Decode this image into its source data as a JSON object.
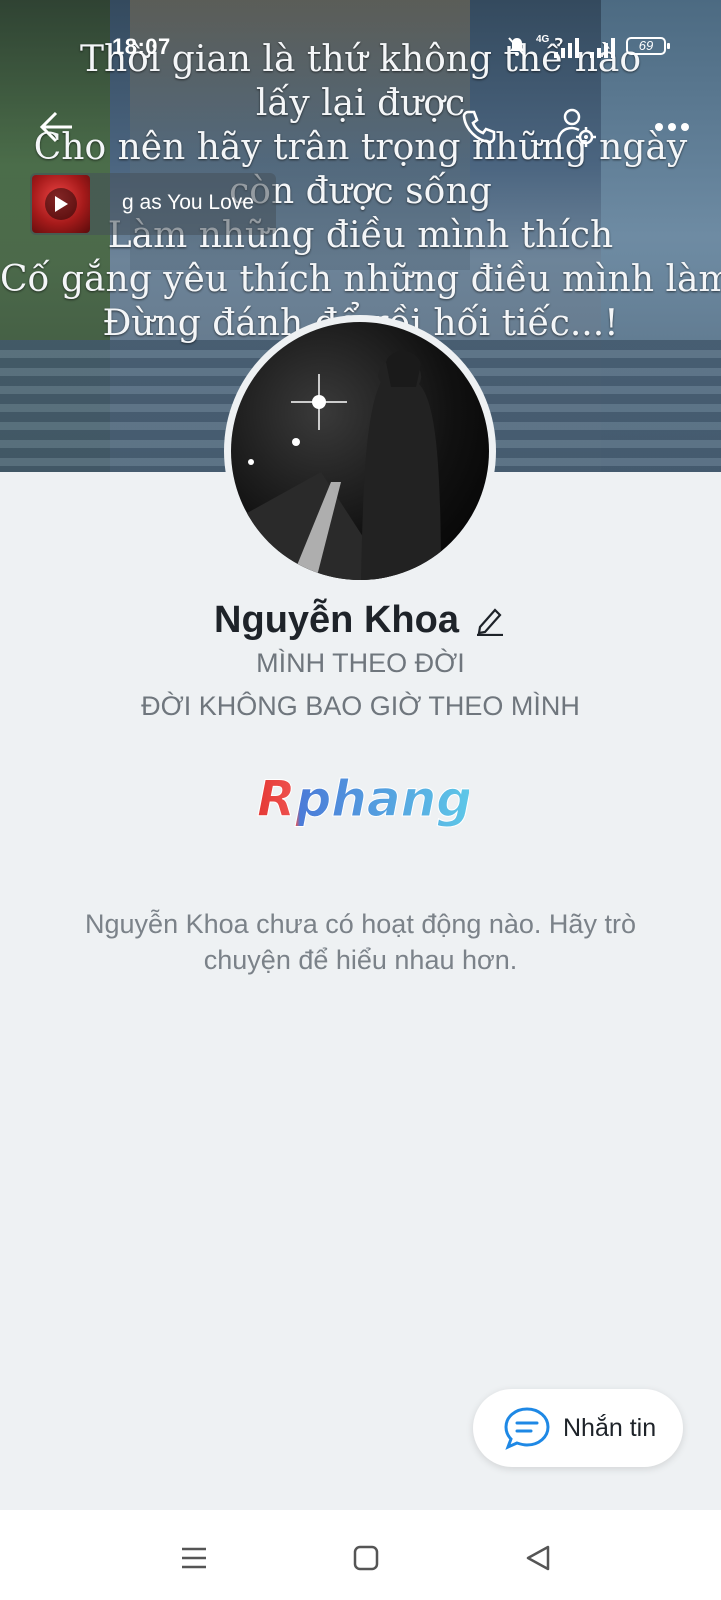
{
  "status_bar": {
    "time": "18:07",
    "network": "4G",
    "battery": "69",
    "icons": [
      "mute-icon",
      "signal-icon",
      "signal-icon",
      "battery-icon"
    ]
  },
  "cover": {
    "quote_lines": [
      "Thời gian là thứ không thể nào",
      "lấy lại được",
      "Cho nên hãy trân trọng những ngày",
      "còn được sống",
      "Làm những điều mình thích",
      "Cố gắng yêu thích những điều mình làm",
      "Đừng đánh để rồi hối tiếc...!"
    ]
  },
  "top_actions": [
    "back-arrow-icon",
    "phone-icon",
    "user-settings-icon",
    "more-icon"
  ],
  "music": {
    "title": "g as You Love"
  },
  "profile": {
    "name": "Nguyễn Khoa",
    "bio_line1": "MÌNH THEO ĐỜI",
    "bio_line2": "ĐỜI KHÔNG BAO GIỜ THEO MÌNH"
  },
  "watermark": {
    "text": "Rphang"
  },
  "empty_state": {
    "text": "Nguyễn Khoa chưa có hoạt động nào. Hãy trò chuyện để hiểu nhau hơn."
  },
  "fab": {
    "label": "Nhắn tin",
    "icon": "chat-bubble-icon",
    "accent": "#1e88e5"
  },
  "nav_bar": {
    "icons": [
      "menu-icon",
      "home-square-icon",
      "back-triangle-icon"
    ]
  }
}
